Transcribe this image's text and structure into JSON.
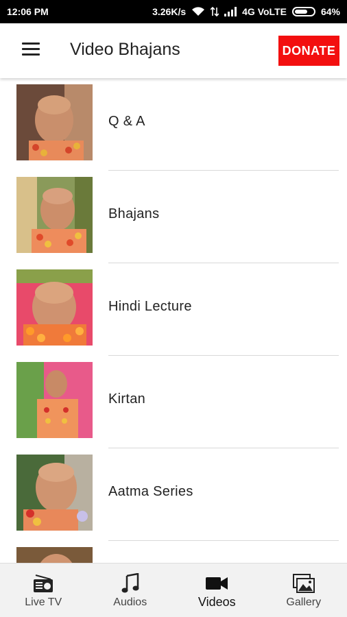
{
  "status_bar": {
    "time": "12:06 PM",
    "network_speed": "3.26K/s",
    "signal_text": "4G VoLTE",
    "battery_percent": "64%",
    "battery_level": 0.64
  },
  "app_bar": {
    "title": "Video Bhajans",
    "menu_icon": "hamburger-menu-icon",
    "donate_label": "DONATE"
  },
  "colors": {
    "donate": "#f30f0f",
    "status_bar": "#000000",
    "bottom_nav": "#f2f2f2"
  },
  "list": {
    "items": [
      {
        "label": "Q & A"
      },
      {
        "label": "Bhajans"
      },
      {
        "label": "Hindi Lecture"
      },
      {
        "label": "Kirtan"
      },
      {
        "label": "Aatma Series"
      },
      {
        "label": ""
      }
    ]
  },
  "bottom_nav": {
    "items": [
      {
        "label": "Live TV",
        "icon": "radio-icon"
      },
      {
        "label": "Audios",
        "icon": "music-note-icon"
      },
      {
        "label": "Videos",
        "icon": "video-camera-icon",
        "active": true
      },
      {
        "label": "Gallery",
        "icon": "gallery-images-icon"
      }
    ]
  }
}
